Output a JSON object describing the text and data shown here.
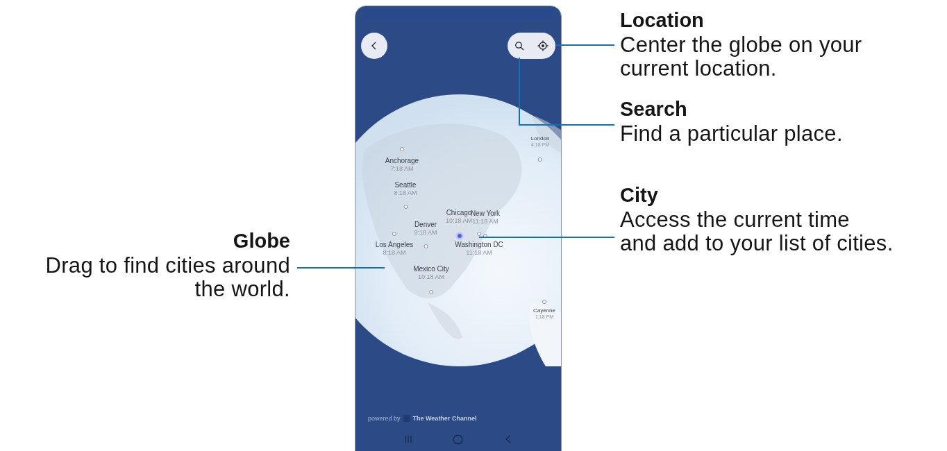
{
  "callouts": {
    "left": [
      {
        "title": "Globe",
        "text": "Drag to find cities around\nthe world."
      }
    ],
    "right": [
      {
        "title": "Location",
        "text": "Center the globe on your\ncurrent location."
      },
      {
        "title": "Search",
        "text": "Find a particular place."
      },
      {
        "title": "City",
        "text": "Access the current time\nand add to your list of cities."
      }
    ]
  },
  "phone": {
    "cities": [
      {
        "name": "Anchorage",
        "time": "7:18 AM",
        "selected": false
      },
      {
        "name": "Seattle",
        "time": "8:18 AM",
        "selected": false
      },
      {
        "name": "Chicago",
        "time": "10:18 AM",
        "selected": true
      },
      {
        "name": "New York",
        "time": "11:18 AM",
        "selected": false
      },
      {
        "name": "Denver",
        "time": "9:18 AM",
        "selected": false
      },
      {
        "name": "Los Angeles",
        "time": "8:18 AM",
        "selected": false
      },
      {
        "name": "Washington DC",
        "time": "11:18 AM",
        "selected": false
      },
      {
        "name": "Mexico City",
        "time": "10:18 AM",
        "selected": false
      },
      {
        "name": "London",
        "time": "4:18 PM",
        "selected": false
      },
      {
        "name": "Cayenne",
        "time": "1:18 PM",
        "selected": false
      }
    ],
    "footer": {
      "prefix": "powered by",
      "brand": "The Weather Channel"
    }
  }
}
